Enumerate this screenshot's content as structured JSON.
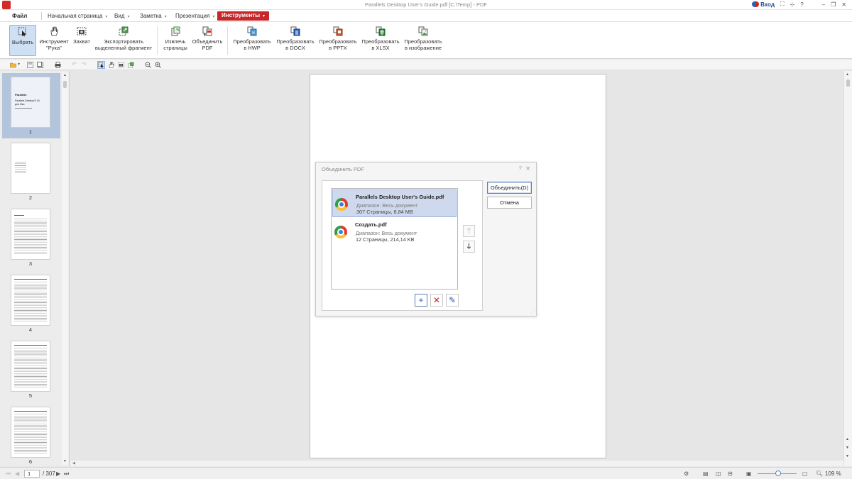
{
  "window": {
    "title": "Parallels Desktop User's Guide.pdf [C:\\Temp] - PDF",
    "login": "Вход"
  },
  "menu": {
    "file": "Файл",
    "home": "Начальная страница",
    "view": "Вид",
    "note": "Заметка",
    "present": "Презентация",
    "tools": "Инструменты"
  },
  "ribbon": {
    "select": "Выбрать",
    "hand": [
      "Инструмент",
      "\"Рука\""
    ],
    "capture": "Захват",
    "export": [
      "Экспортировать",
      "выделенный фрагмент"
    ],
    "extract": [
      "Извлечь",
      "страницы"
    ],
    "merge": [
      "Объединить",
      "PDF"
    ],
    "to_hwp": [
      "Преобразовать",
      "в HWP"
    ],
    "to_docx": [
      "Преобразовать",
      "в DOCX"
    ],
    "to_pptx": [
      "Преобразовать",
      "в PPTX"
    ],
    "to_xlsx": [
      "Преобразовать",
      "в XLSX"
    ],
    "to_image": [
      "Преобразовать",
      "в изображение"
    ]
  },
  "thumbnails": {
    "labels": [
      "1",
      "2",
      "3",
      "4",
      "5",
      "6"
    ],
    "first_page": {
      "brand": "Parallels",
      "title": "Parallels Desktop® 16",
      "subtitle": "для Mac"
    }
  },
  "dialog": {
    "title": "Объединить PDF",
    "help": "?",
    "files": [
      {
        "name": "Parallels Desktop User's Guide.pdf",
        "range": "Диапазон: Весь документ",
        "size": "307 Страницы, 8,84 MB"
      },
      {
        "name": "Создать.pdf",
        "range": "Диапазон: Весь документ",
        "size": "12 Страницы, 214,14 KB"
      }
    ],
    "merge_btn": "Объединить(D)",
    "cancel_btn": "Отмена"
  },
  "status": {
    "page": "1",
    "total": "/ 307",
    "zoom": "109 %"
  },
  "colors": {
    "accent": "#c8272a",
    "selection": "#cfd9ee"
  }
}
